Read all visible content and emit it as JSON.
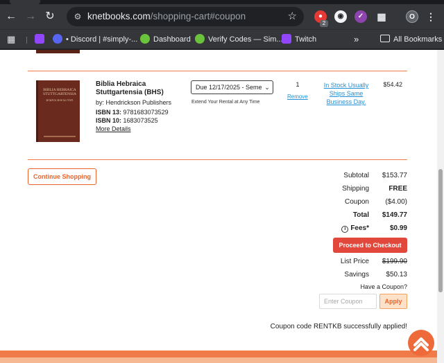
{
  "browser": {
    "url_domain": "knetbooks.com",
    "url_path": "/shopping-cart#coupon",
    "extension_badge": "2",
    "profile_initial": "O",
    "bookmarks": [
      {
        "label": "",
        "icon": "twitch-icon",
        "color": "#9146ff"
      },
      {
        "label": "• Discord | #simply-...",
        "icon": "discord-icon",
        "color": "#5865f2"
      },
      {
        "label": "Dashboard",
        "icon": "check-badge-icon",
        "color": "#6ac23d"
      },
      {
        "label": "Verify Codes — Sim...",
        "icon": "check-badge-icon",
        "color": "#6ac23d"
      },
      {
        "label": "Twitch",
        "icon": "twitch-icon",
        "color": "#9146ff"
      }
    ],
    "overflow_label": "»",
    "all_bookmarks_label": "All Bookmarks"
  },
  "cart": {
    "item": {
      "cover_title": "BIBLIA HEBRAICA STUTTGARTENSIA",
      "cover_subtitle": "תורה נביאים וכתובים",
      "title": "Biblia Hebraica Stuttgartensia (BHS)",
      "publisher": "by: Hendrickson Publishers",
      "isbn13_label": "ISBN 13:",
      "isbn13": "9781683073529",
      "isbn10_label": "ISBN 10:",
      "isbn10": "1683073525",
      "more_details": "More Details",
      "due_date": "Due 12/17/2025 - Seme",
      "extend_text": "Extend Your Rental at Any Time",
      "quantity": "1",
      "remove_label": "Remove",
      "stock_status": "In Stock Usually Ships Same Business Day.",
      "price": "$54.42"
    },
    "continue_label": "Continue Shopping",
    "summary": {
      "subtotal_label": "Subtotal",
      "subtotal": "$153.77",
      "shipping_label": "Shipping",
      "shipping": "FREE",
      "coupon_label": "Coupon",
      "coupon": "($4.00)",
      "total_label": "Total",
      "total": "$149.77",
      "fees_label": "Fees*",
      "fees": "$0.99",
      "checkout_label": "Proceed to Checkout",
      "list_price_label": "List Price",
      "list_price": "$199.90",
      "savings_label": "Savings",
      "savings": "$50.13"
    },
    "coupon_question": "Have a Coupon?",
    "coupon_placeholder": "Enter Coupon",
    "apply_label": "Apply",
    "coupon_success": "Coupon code RENTKB successfully applied!"
  }
}
